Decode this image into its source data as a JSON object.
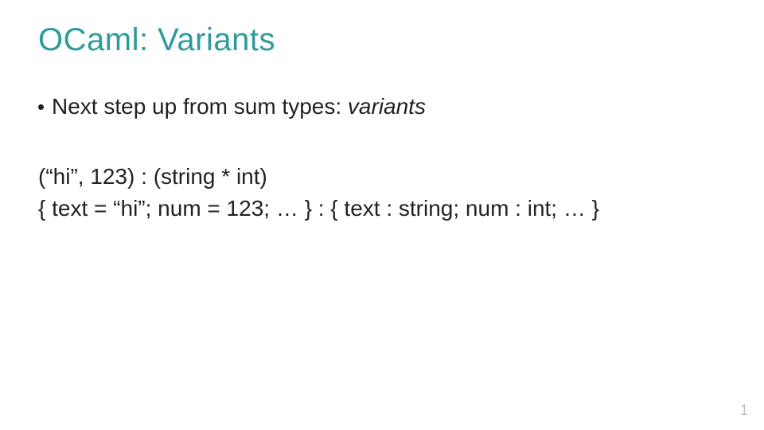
{
  "title": "OCaml: Variants",
  "bullet_prefix": "Next step up from sum types: ",
  "bullet_italic": "variants",
  "code_line_1": "(“hi”, 123) : (string * int)",
  "code_line_2": "{ text = “hi”; num = 123; … } : { text : string; num : int; … }",
  "page_number": "1"
}
